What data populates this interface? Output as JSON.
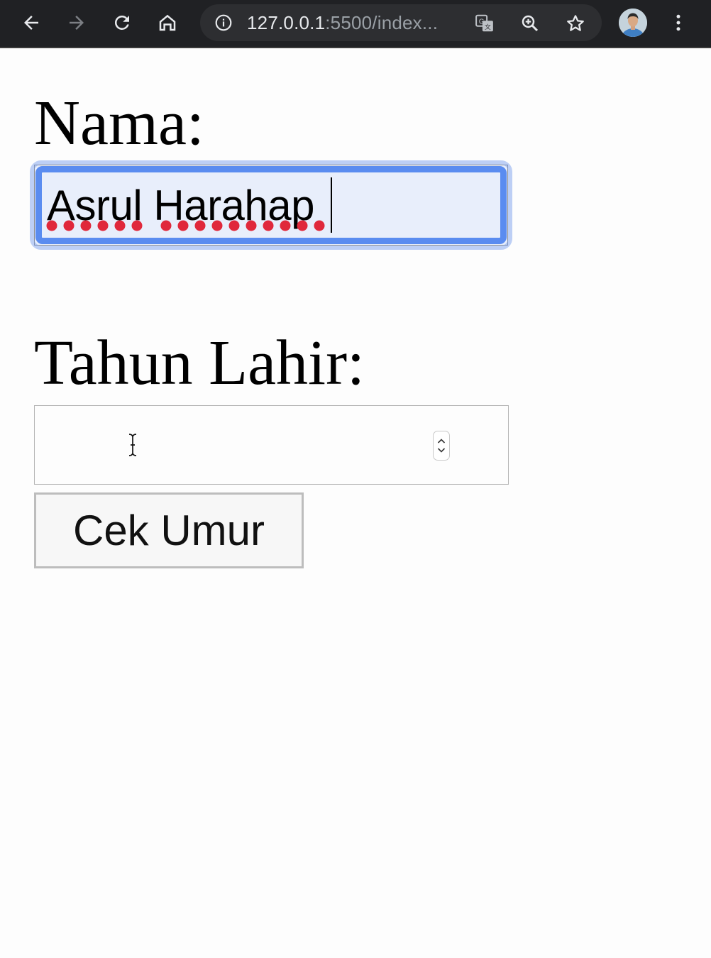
{
  "browser": {
    "url_host": "127.0.0.1",
    "url_rest": ":5500/index...",
    "icons": [
      "back-arrow-icon",
      "forward-arrow-icon",
      "reload-icon",
      "home-icon",
      "site-info-icon",
      "translate-icon",
      "zoom-icon",
      "bookmark-star-icon",
      "profile-avatar",
      "menu-kebab-icon"
    ]
  },
  "form": {
    "name_label": "Nama:",
    "name_value": "Asrul Harahap",
    "year_label": "Tahun Lahir:",
    "year_value": "",
    "submit_label": "Cek Umur"
  },
  "colors": {
    "toolbar_bg": "#202124",
    "focus_ring": "#5a8cf0",
    "autofill_bg": "#e8eefb",
    "spellcheck_dot": "#e0283b"
  }
}
